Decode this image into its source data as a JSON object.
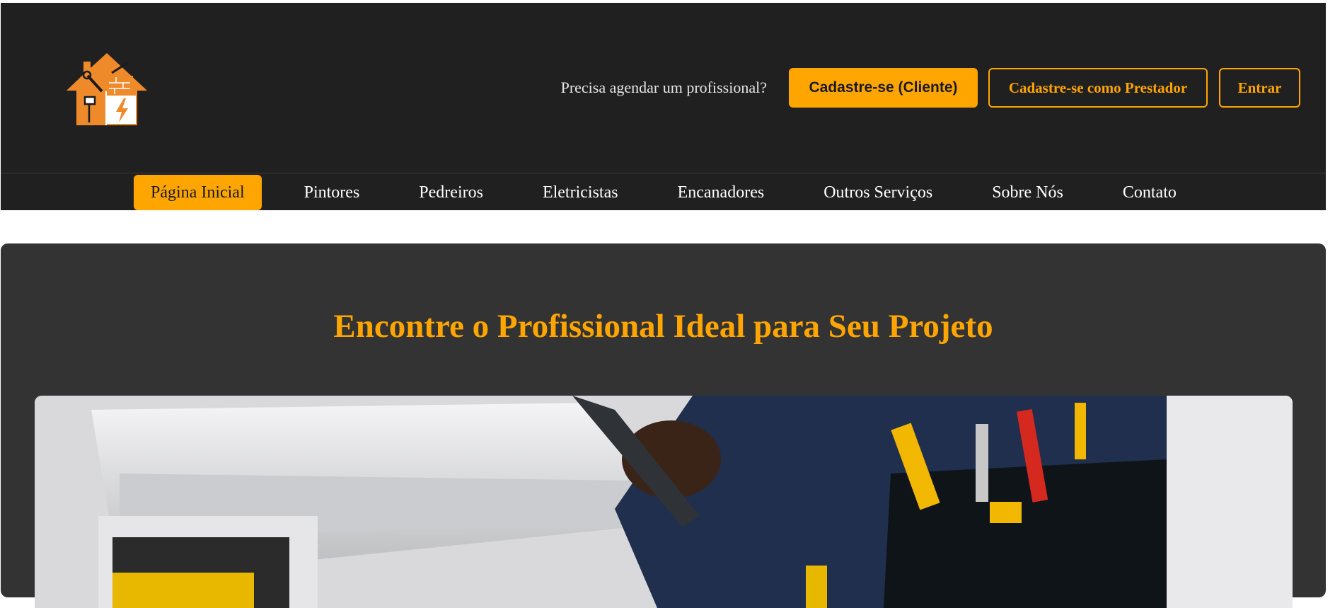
{
  "header": {
    "logo_name": "house-tools-logo",
    "tagline": "Precisa agendar um profissional?",
    "buttons": {
      "signup_client": "Cadastre-se (Cliente)",
      "signup_provider": "Cadastre-se como Prestador",
      "login": "Entrar"
    }
  },
  "nav": {
    "items": [
      {
        "label": "Página Inicial",
        "active": true
      },
      {
        "label": "Pintores"
      },
      {
        "label": "Pedreiros"
      },
      {
        "label": "Eletricistas"
      },
      {
        "label": "Encanadores"
      },
      {
        "label": "Outros Serviços"
      },
      {
        "label": "Sobre Nós"
      },
      {
        "label": "Contato"
      }
    ]
  },
  "hero": {
    "title": "Encontre o Profissional Ideal para Seu Projeto",
    "image_subject": "plumber-fixing-sink"
  },
  "colors": {
    "accent": "#ffa500",
    "header_bg": "#212021",
    "hero_bg": "#333333"
  }
}
